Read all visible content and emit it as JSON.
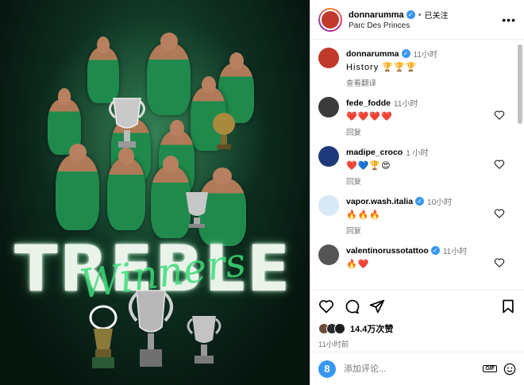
{
  "post_image": {
    "big_text": "TREBLE",
    "script_text": "Winners"
  },
  "header": {
    "username": "donnarumma",
    "separator": "•",
    "follow_label": "已关注",
    "location": "Parc Des Princes",
    "more_icon": "more-horizontal-icon"
  },
  "comments": [
    {
      "user": "donnarumma",
      "verified": true,
      "time": "11小时",
      "text": "History 🏆🏆🏆",
      "reply": "查看翻译",
      "avatar_color": "#c0392b",
      "has_heart": false
    },
    {
      "user": "fede_fodde",
      "verified": false,
      "time": "11小时",
      "text": "❤️❤️❤️❤️",
      "reply": "回复",
      "avatar_color": "#3b3b3b",
      "has_heart": true
    },
    {
      "user": "madipe_croco",
      "verified": false,
      "time": "1 小时",
      "text": "❤️💙🏆😍",
      "reply": "回复",
      "avatar_color": "#1f3a7a",
      "has_heart": true
    },
    {
      "user": "vapor.wash.italia",
      "verified": true,
      "time": "10小时",
      "text": "🔥🔥🔥",
      "reply": "回复",
      "avatar_color": "#d9e8f5",
      "has_heart": true
    },
    {
      "user": "valentinorussotattoo",
      "verified": true,
      "time": "11小时",
      "text": "🔥❤️",
      "reply": "",
      "avatar_color": "#555555",
      "has_heart": true
    }
  ],
  "actions": {
    "like_icon": "heart-icon",
    "comment_icon": "comment-icon",
    "share_icon": "share-icon",
    "save_icon": "bookmark-icon"
  },
  "likes": {
    "count_text": "14.4万次赞",
    "avatar_colors": [
      "#6b4b3a",
      "#2c2c2c",
      "#1b1b1b"
    ]
  },
  "post_time": "11小时前",
  "comment_box": {
    "avatar_letter": "8",
    "placeholder": "添加评论...",
    "gif_label": "GIF",
    "emoji_icon": "emoji-icon"
  },
  "colors": {
    "verified": "#3897f0",
    "accent_green": "#1f8a4c",
    "heart_red": "#ed4956"
  }
}
